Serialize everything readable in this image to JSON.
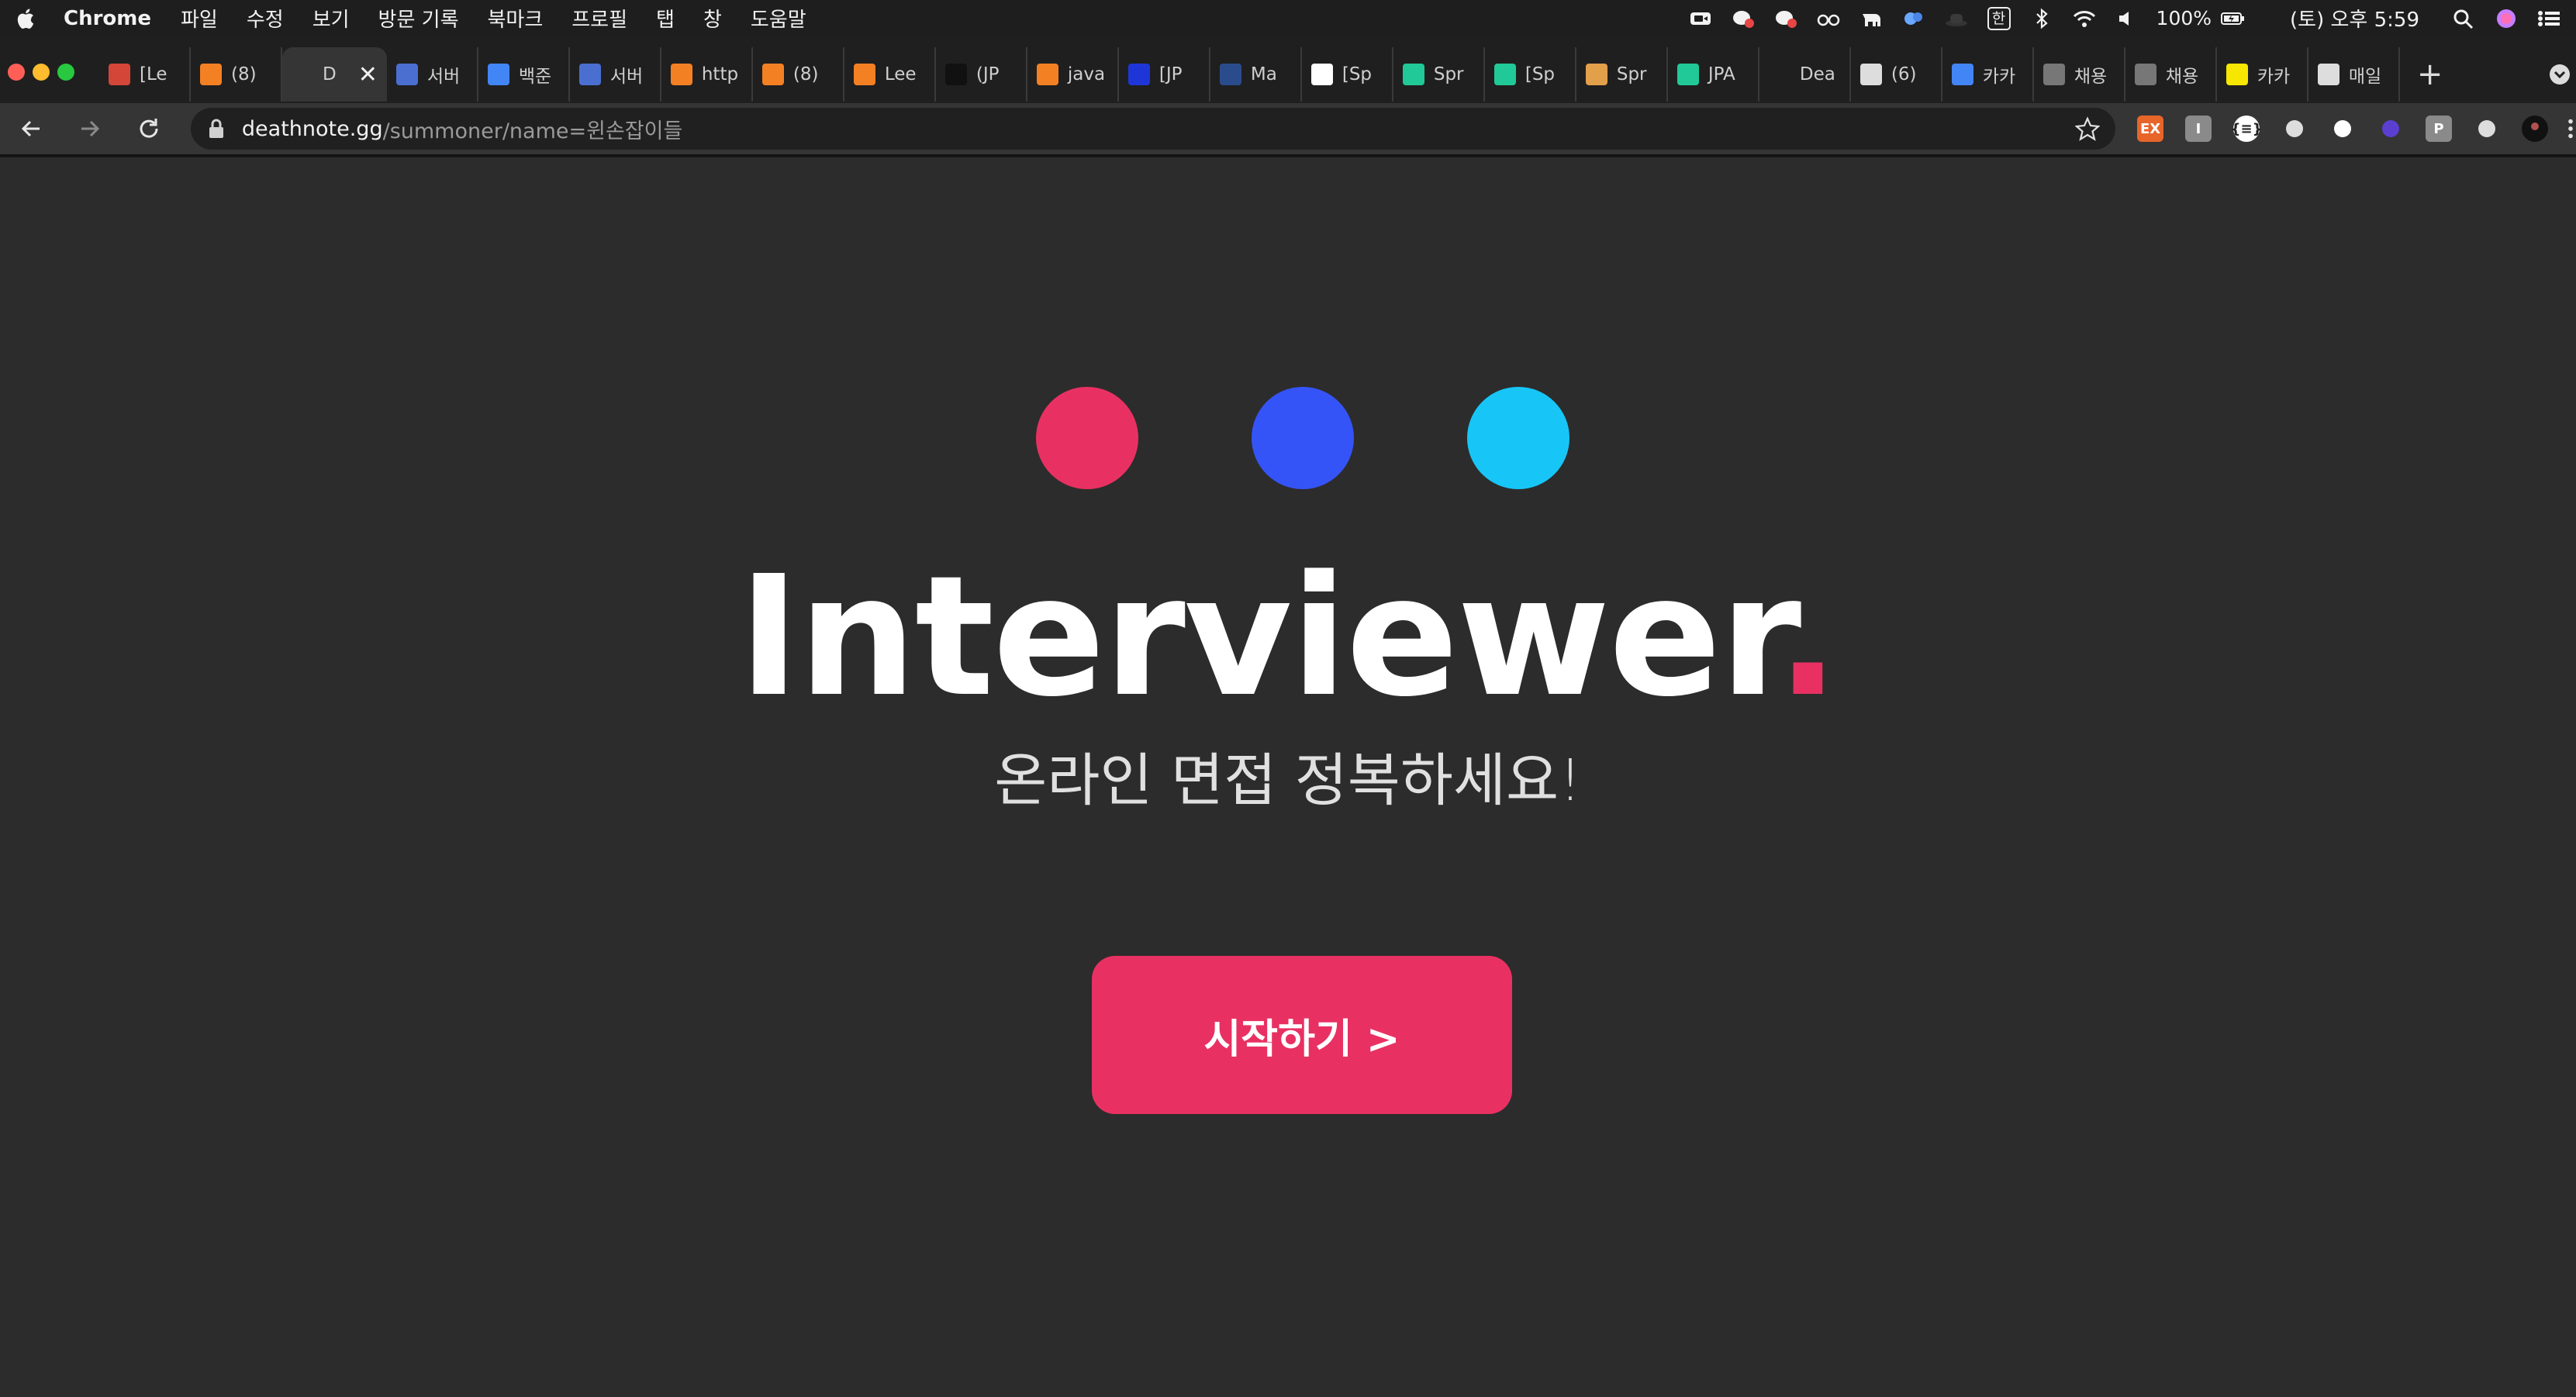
{
  "menubar": {
    "app_name": "Chrome",
    "menus": [
      "파일",
      "수정",
      "보기",
      "방문 기록",
      "북마크",
      "프로필",
      "탭",
      "창",
      "도움말"
    ],
    "ime_label": "한",
    "battery": "100%",
    "datetime": "(토) 오후 5:59"
  },
  "tabs": [
    {
      "label": "[Le",
      "icon": "gmail-icon",
      "color": "#d44638"
    },
    {
      "label": "(8)",
      "icon": "stackoverflow-icon",
      "color": "#f48024"
    },
    {
      "label": "D",
      "icon": "deathnote-icon",
      "color": "#ffffff",
      "active": true
    },
    {
      "label": "서버",
      "icon": "code-icon",
      "color": "#4a6fd1"
    },
    {
      "label": "백준",
      "icon": "google-icon",
      "color": "#4285f4"
    },
    {
      "label": "서버",
      "icon": "code-icon",
      "color": "#4a6fd1"
    },
    {
      "label": "http",
      "icon": "stackoverflow-icon",
      "color": "#f48024"
    },
    {
      "label": "(8)",
      "icon": "stackoverflow-icon",
      "color": "#f48024"
    },
    {
      "label": "Lee",
      "icon": "stackoverflow-icon",
      "color": "#f48024"
    },
    {
      "label": "(JP",
      "icon": "tistory-icon",
      "color": "#111111"
    },
    {
      "label": "java",
      "icon": "stackoverflow-icon",
      "color": "#f48024"
    },
    {
      "label": "[JP",
      "icon": "xj-icon",
      "color": "#1e36d8"
    },
    {
      "label": "Ma",
      "icon": "maven-icon",
      "color": "#2b4c8c"
    },
    {
      "label": "[Sp",
      "icon": "velog-v-icon",
      "color": "#ffffff"
    },
    {
      "label": "Spr",
      "icon": "velog-icon",
      "color": "#20c997"
    },
    {
      "label": "[Sp",
      "icon": "velog-icon",
      "color": "#20c997"
    },
    {
      "label": "Spr",
      "icon": "image-icon",
      "color": "#e3a04a"
    },
    {
      "label": "JPA",
      "icon": "velog-icon",
      "color": "#20c997"
    },
    {
      "label": "Dea",
      "icon": "deathnote-icon",
      "color": "#ffffff"
    },
    {
      "label": "(6)",
      "icon": "chat-icon",
      "color": "#dddddd"
    },
    {
      "label": "카카",
      "icon": "google-icon",
      "color": "#4285f4"
    },
    {
      "label": "채용",
      "icon": "globe-icon",
      "color": "#777777"
    },
    {
      "label": "채용",
      "icon": "globe-icon",
      "color": "#777777"
    },
    {
      "label": "카카",
      "icon": "kakao-icon",
      "color": "#f7e600"
    },
    {
      "label": "매일",
      "icon": "monitor-icon",
      "color": "#dddddd"
    }
  ],
  "address": {
    "host": "deathnote.gg",
    "path": "/summoner/name=윈손잡이들"
  },
  "extensions": [
    {
      "name": "ex-extension-icon",
      "label": "EX",
      "color": "#e8652a"
    },
    {
      "name": "i-extension-icon",
      "label": "I",
      "color": "#8a8a8a"
    },
    {
      "name": "json-extension-icon",
      "label": "{≡}",
      "color": "#ffffff"
    },
    {
      "name": "pen-extension-icon",
      "label": "",
      "color": "#dddddd"
    },
    {
      "name": "github-icon",
      "label": "",
      "color": "#ffffff"
    },
    {
      "name": "layers-extension-icon",
      "label": "",
      "color": "#5b3fd1"
    },
    {
      "name": "p-extension-icon",
      "label": "P",
      "color": "#8a8a8a"
    },
    {
      "name": "puzzle-icon",
      "label": "",
      "color": "#dddddd"
    }
  ],
  "hero": {
    "title": "Interviewer",
    "title_period": ".",
    "subtitle": "온라인 면접 정복하세요!",
    "cta_label": "시작하기 >"
  },
  "colors": {
    "red": "#e83162",
    "blue": "#3554f7",
    "cyan": "#17c6f7",
    "background": "#2c2c2c"
  }
}
